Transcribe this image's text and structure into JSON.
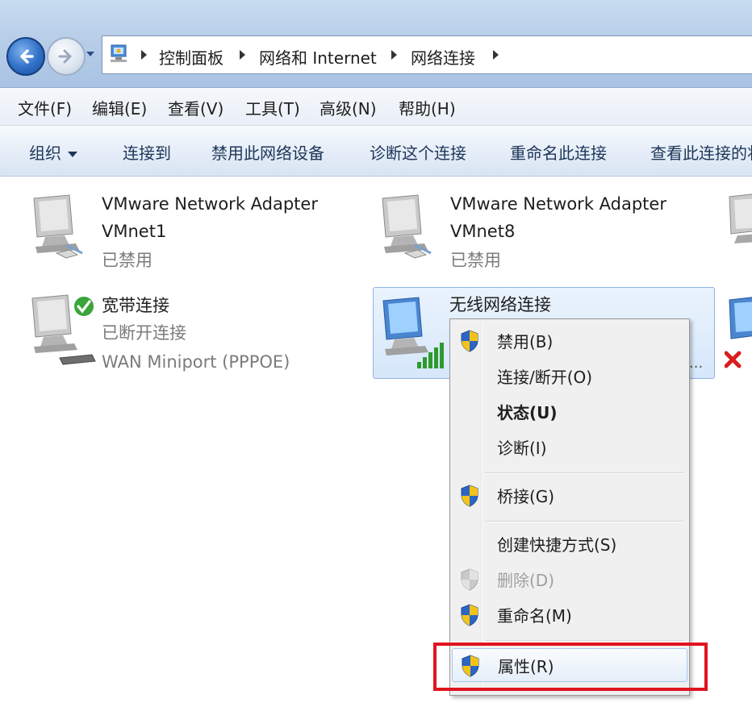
{
  "address_bar": {
    "breadcrumbs": [
      "控制面板",
      "网络和 Internet",
      "网络连接"
    ]
  },
  "menu_bar": {
    "items": [
      "文件(F)",
      "编辑(E)",
      "查看(V)",
      "工具(T)",
      "高级(N)",
      "帮助(H)"
    ]
  },
  "command_bar": {
    "organize": "组织",
    "items": [
      "连接到",
      "禁用此网络设备",
      "诊断这个连接",
      "重命名此连接",
      "查看此连接的状"
    ]
  },
  "connections": [
    {
      "name_line1": "VMware Network Adapter",
      "name_line2": "VMnet1",
      "status": "已禁用",
      "icon": "wired-network-icon"
    },
    {
      "name_line1": "VMware Network Adapter",
      "name_line2": "VMnet8",
      "status": "已禁用",
      "icon": "wired-network-icon"
    },
    {
      "name_line1": "宽带连接",
      "name_line2": "已断开连接",
      "status": "WAN Miniport (PPPOE)",
      "icon": "broadband-network-icon"
    },
    {
      "name_line1": "无线网络连接",
      "name_line2": "",
      "status": "",
      "ellipsis": "...",
      "icon": "wireless-network-icon"
    }
  ],
  "context_menu": {
    "items": [
      {
        "label": "禁用(B)",
        "shield": true
      },
      {
        "label": "连接/断开(O)",
        "shield": false
      },
      {
        "label": "状态(U)",
        "shield": false,
        "bold": true
      },
      {
        "label": "诊断(I)",
        "shield": false
      },
      {
        "label": "桥接(G)",
        "shield": true
      },
      {
        "label": "创建快捷方式(S)",
        "shield": false
      },
      {
        "label": "删除(D)",
        "shield": true,
        "disabled": true
      },
      {
        "label": "重命名(M)",
        "shield": true
      },
      {
        "label": "属性(R)",
        "shield": true,
        "hover": true
      }
    ]
  },
  "colors": {
    "highlight_box": "#e0141e",
    "selection": "#d6e7fb",
    "signal_green": "#2e9a2e"
  }
}
